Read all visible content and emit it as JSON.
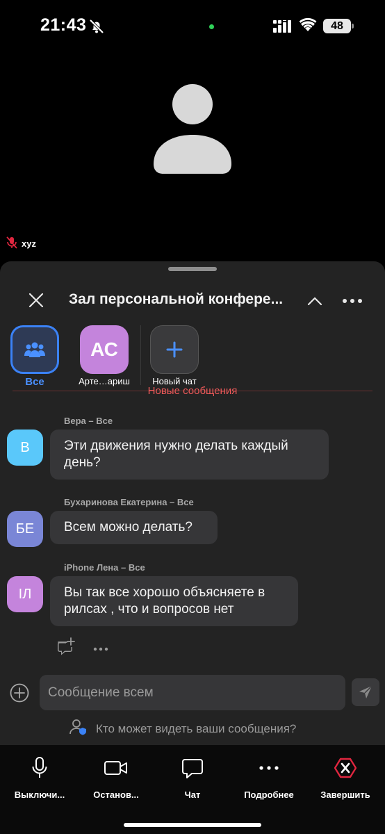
{
  "status_bar": {
    "time": "21:43",
    "battery": "48"
  },
  "video": {
    "participant_name": "xyz"
  },
  "chat": {
    "title": "Зал персональной конфере...",
    "recipients": [
      {
        "label": "Все"
      },
      {
        "initials": "АС",
        "label": "Арте…ариш"
      },
      {
        "label": "Новый чат"
      }
    ],
    "new_messages_label": "Новые сообщения",
    "messages": [
      {
        "sender": "Вера – Все",
        "initials": "В",
        "text_line1": "Эти движения нужно делать каждый",
        "text_line2": "день?",
        "color": "#5ac8fa"
      },
      {
        "sender": "Бухаринова Екатерина – Все",
        "initials": "БЕ",
        "text_line1": "Всем можно делать?",
        "color": "#7a86d6"
      },
      {
        "sender": "iPhone Лена – Все",
        "initials": "ІЛ",
        "text_line1": "Вы так все хорошо объясняете в",
        "text_line2": "рилсах , что и вопросов нет",
        "color": "#c484dc"
      }
    ],
    "input_placeholder": "Сообщение всем",
    "visibility_question": "Кто может видеть ваши сообщения?"
  },
  "toolbar": {
    "mute_label": "Выключи...",
    "video_label": "Останов...",
    "chat_label": "Чат",
    "more_label": "Подробнее",
    "end_label": "Завершить"
  },
  "colors": {
    "accent": "#3b82f6",
    "danger": "#f05a5a",
    "end": "#e0263f"
  }
}
